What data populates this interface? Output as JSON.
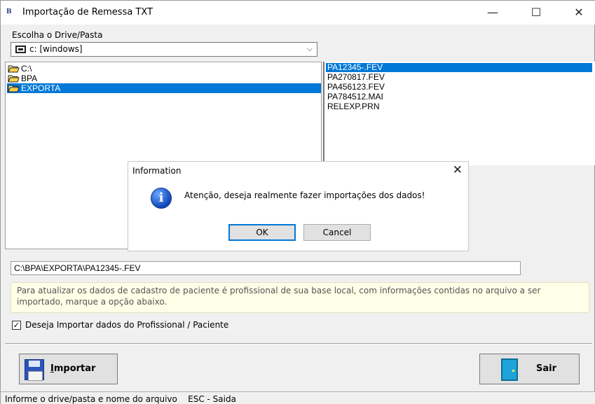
{
  "window": {
    "title": "Importação de Remessa TXT",
    "app_icon_text": "B",
    "minimize": "—",
    "maximize": "☐",
    "close": "✕"
  },
  "drive": {
    "label": "Escolha o Drive/Pasta",
    "selected": "c: [windows]",
    "chevron": "⌵"
  },
  "directories": [
    {
      "name": "C:\\",
      "selected": false
    },
    {
      "name": "BPA",
      "selected": false
    },
    {
      "name": "EXPORTA",
      "selected": true
    }
  ],
  "files": [
    {
      "name": "PA12345-.FEV",
      "selected": true
    },
    {
      "name": "PA270817.FEV",
      "selected": false
    },
    {
      "name": "PA456123.FEV",
      "selected": false
    },
    {
      "name": "PA784512.MAI",
      "selected": false
    },
    {
      "name": "RELEXP.PRN",
      "selected": false
    }
  ],
  "dialog": {
    "title": "Information",
    "close": "✕",
    "icon": "i",
    "message": "Atenção, deseja realmente fazer importações dos dados!",
    "ok_label": "OK",
    "cancel_label": "Cancel"
  },
  "path": {
    "value": "C:\\BPA\\EXPORTA\\PA12345-.FEV"
  },
  "info_text": "Para atualizar os dados de cadastro de paciente é profissional de sua base local, com informações contidas no arquivo a ser importado, marque a opção abaixo.",
  "checkbox": {
    "checked": true,
    "mark": "✓",
    "label": "Deseja Importar dados do Profissional / Paciente"
  },
  "buttons": {
    "import_label": "Importar",
    "exit_label": "Sair"
  },
  "status": {
    "text": "Informe o drive/pasta e nome do arquivo    ESC - Saida"
  },
  "colors": {
    "selection": "#0078d7",
    "window_bg": "#f0f0f0",
    "info_bg": "#ffffe8"
  }
}
